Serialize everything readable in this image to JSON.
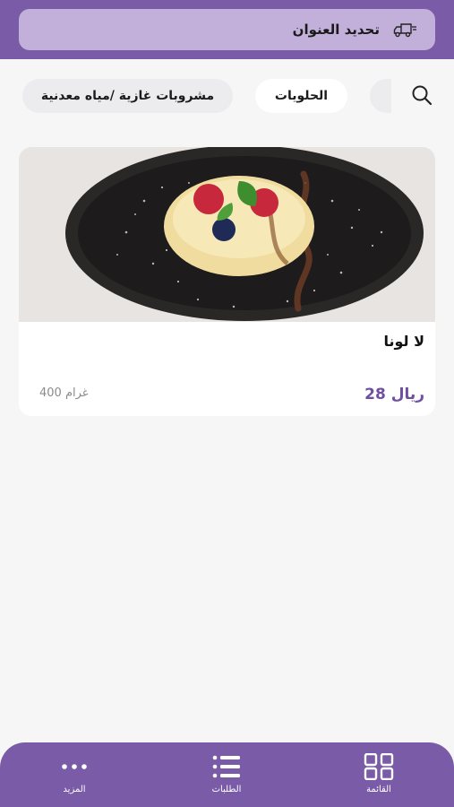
{
  "header": {
    "address_label": "تحديد العنوان",
    "truck_icon": "delivery-truck-icon"
  },
  "categories": {
    "search_icon": "search-icon",
    "items": [
      {
        "label": ""
      },
      {
        "label": "الحلويات"
      },
      {
        "label": "مشروبات غازية /مياه معدنية"
      }
    ]
  },
  "product": {
    "name": "لا لونا",
    "price": "28 ريال",
    "weight": "400 غرام",
    "image_icon": "dessert-photo"
  },
  "bottom_nav": {
    "items": [
      {
        "label": "القائمة",
        "icon": "grid-icon"
      },
      {
        "label": "الطلبات",
        "icon": "list-icon"
      },
      {
        "label": "المزيد",
        "icon": "more-dots-icon"
      }
    ]
  },
  "colors": {
    "brand": "#7a5ba7",
    "address_box": "#c2b0db",
    "price": "#6e4fa0",
    "chip_grey": "#ececee"
  }
}
